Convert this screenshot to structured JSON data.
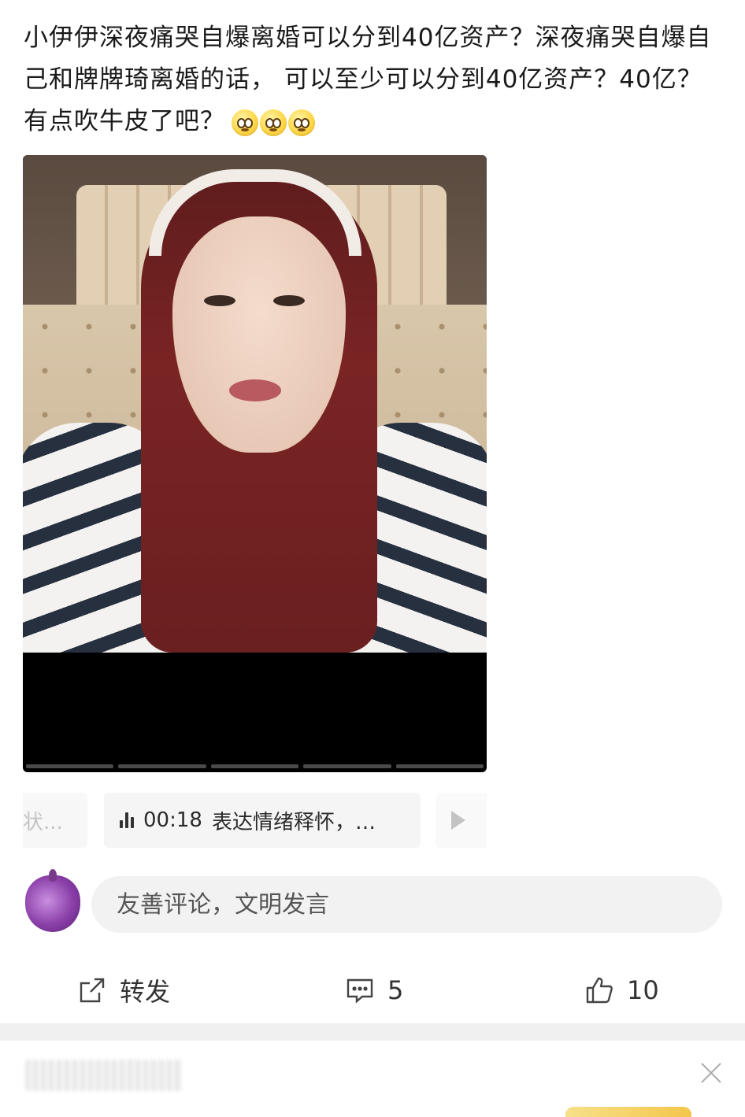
{
  "post": {
    "text": "小伊伊深夜痛哭自爆离婚可以分到40亿资产？深夜痛哭自爆自己和牌牌琦离婚的话， 可以至少可以分到40亿资产？40亿？有点吹牛皮了吧？",
    "emojis": [
      "thinking-emoji",
      "thinking-emoji",
      "thinking-emoji"
    ]
  },
  "video": {
    "segments": 5
  },
  "chapters": {
    "prev_label": "状...",
    "current_time": "00:18",
    "current_label": "表达情绪释怀，…"
  },
  "comment": {
    "placeholder": "友善评论，文明发言"
  },
  "actions": {
    "repost_label": "转发",
    "comment_count": "5",
    "like_count": "10"
  },
  "colors": {
    "background": "#ffffff",
    "input_bg": "#f2f2f2",
    "divider": "#f0f0f0",
    "text": "#1a1a1a"
  }
}
